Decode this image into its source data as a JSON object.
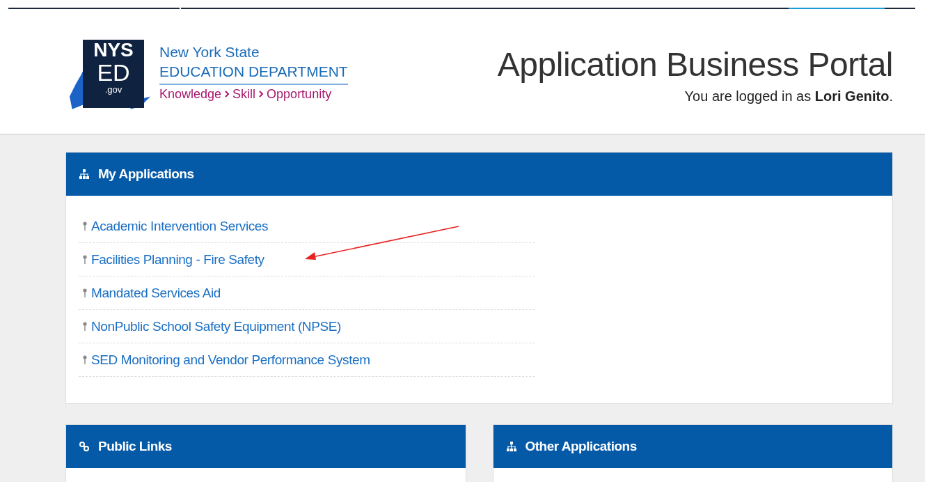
{
  "logo": {
    "mark_lines": [
      "NYS",
      "ED",
      ".gov"
    ],
    "name_lines": [
      "New York State",
      "EDUCATION DEPARTMENT"
    ],
    "tagline": [
      "Knowledge",
      "Skill",
      "Opportunity"
    ]
  },
  "header": {
    "title": "Application Business Portal",
    "login_prefix": "You are logged in as ",
    "user": "Lori Genito",
    "login_suffix": "."
  },
  "my_applications": {
    "title": "My Applications",
    "items": [
      {
        "label": "Academic Intervention Services",
        "annotated": false
      },
      {
        "label": "Facilities Planning - Fire Safety",
        "annotated": true
      },
      {
        "label": "Mandated Services Aid",
        "annotated": false
      },
      {
        "label": "NonPublic School Safety Equipment (NPSE)",
        "annotated": false
      },
      {
        "label": "SED Monitoring and Vendor Performance System",
        "annotated": false
      }
    ]
  },
  "panels": [
    {
      "title": "Public Links"
    },
    {
      "title": "Other Applications"
    }
  ]
}
